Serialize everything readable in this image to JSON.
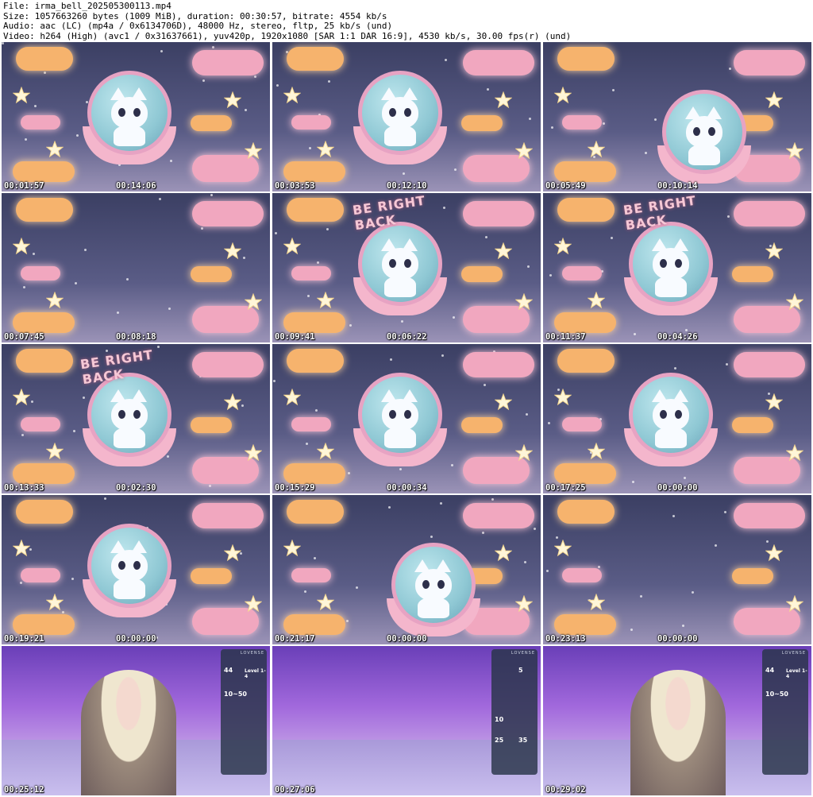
{
  "header": {
    "line1": "File: irma_bell_202505300113.mp4",
    "line2": "Size: 1057663260 bytes (1009 MiB), duration: 00:30:57, bitrate: 4554 kb/s",
    "line3": "Audio: aac (LC) (mp4a / 0x6134706D), 48000 Hz, stereo, fltp, 25 kb/s (und)",
    "line4": "Video: h264 (High) (avc1 / 0x31637661), yuv420p, 1920x1080 [SAR 1:1 DAR 16:9], 4530 kb/s, 30.00 fps(r) (und)"
  },
  "brb_text": "BE RIGHT BACK",
  "panel": {
    "brand": "LOVENSE",
    "v1": "44",
    "v2": "10~50",
    "v3": "5",
    "v4": "10",
    "v5": "25",
    "v6": "35",
    "level": "Level 1-4"
  },
  "tiles": [
    {
      "ts": "00:01:57",
      "timer": "00:14:06",
      "kind": "brb",
      "brb": false
    },
    {
      "ts": "00:03:53",
      "timer": "00:12:10",
      "kind": "brb",
      "brb": false
    },
    {
      "ts": "00:05:49",
      "timer": "00:10:14",
      "kind": "brb",
      "brb": false
    },
    {
      "ts": "00:07:45",
      "timer": "00:08:18",
      "kind": "brb",
      "brb": false,
      "nocat": true
    },
    {
      "ts": "00:09:41",
      "timer": "00:06:22",
      "kind": "brb",
      "brb": true
    },
    {
      "ts": "00:11:37",
      "timer": "00:04:26",
      "kind": "brb",
      "brb": true
    },
    {
      "ts": "00:13:33",
      "timer": "00:02:30",
      "kind": "brb",
      "brb": true
    },
    {
      "ts": "00:15:29",
      "timer": "00:00:34",
      "kind": "brb",
      "brb": false
    },
    {
      "ts": "00:17:25",
      "timer": "00:00:00",
      "kind": "brb",
      "brb": false
    },
    {
      "ts": "00:19:21",
      "timer": "00:00:00",
      "kind": "brb",
      "brb": false
    },
    {
      "ts": "00:21:17",
      "timer": "00:00:00",
      "kind": "brb",
      "brb": false
    },
    {
      "ts": "00:23:13",
      "timer": "00:00:00",
      "kind": "brb",
      "brb": false,
      "nocat": true
    },
    {
      "ts": "00:25:12",
      "timer": "",
      "kind": "cam",
      "person": true
    },
    {
      "ts": "00:27:06",
      "timer": "",
      "kind": "cam",
      "person": false
    },
    {
      "ts": "00:29:02",
      "timer": "",
      "kind": "cam",
      "person": true
    }
  ],
  "colors": {
    "cloud_orange": "#f6b36d",
    "cloud_pink": "#f1a7bf",
    "sky": "#3b3f63",
    "room": "#a168dc"
  }
}
